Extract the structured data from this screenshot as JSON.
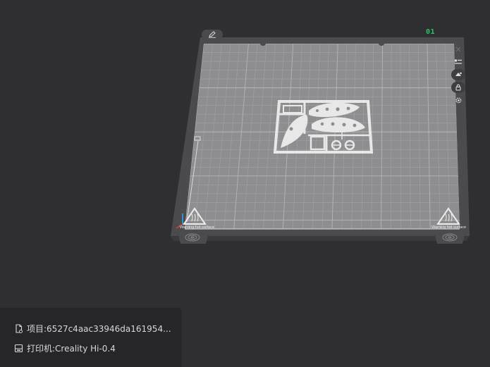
{
  "viewport": {
    "plate_number": "01",
    "warning_label_left": "Warning hot surface",
    "warning_label_right": "Warning hot surface"
  },
  "toolbar": {
    "edit_icon": "pencil-icon",
    "tools": [
      "close-icon",
      "list-icon",
      "auto-orient-icon",
      "lock-icon",
      "settings-gear-icon"
    ]
  },
  "project_info": {
    "project_label": "项目:6527c4aac33946da161954...",
    "printer_label": "打印机:Creality Hi-0.4"
  },
  "colors": {
    "background": "#2f2f31",
    "plate_frame": "#4c4c4f",
    "bed_surface": "#8d8d90",
    "grid_line": "#a9a9ac",
    "model": "#e4e4e4",
    "plate_number": "#27c46b"
  }
}
